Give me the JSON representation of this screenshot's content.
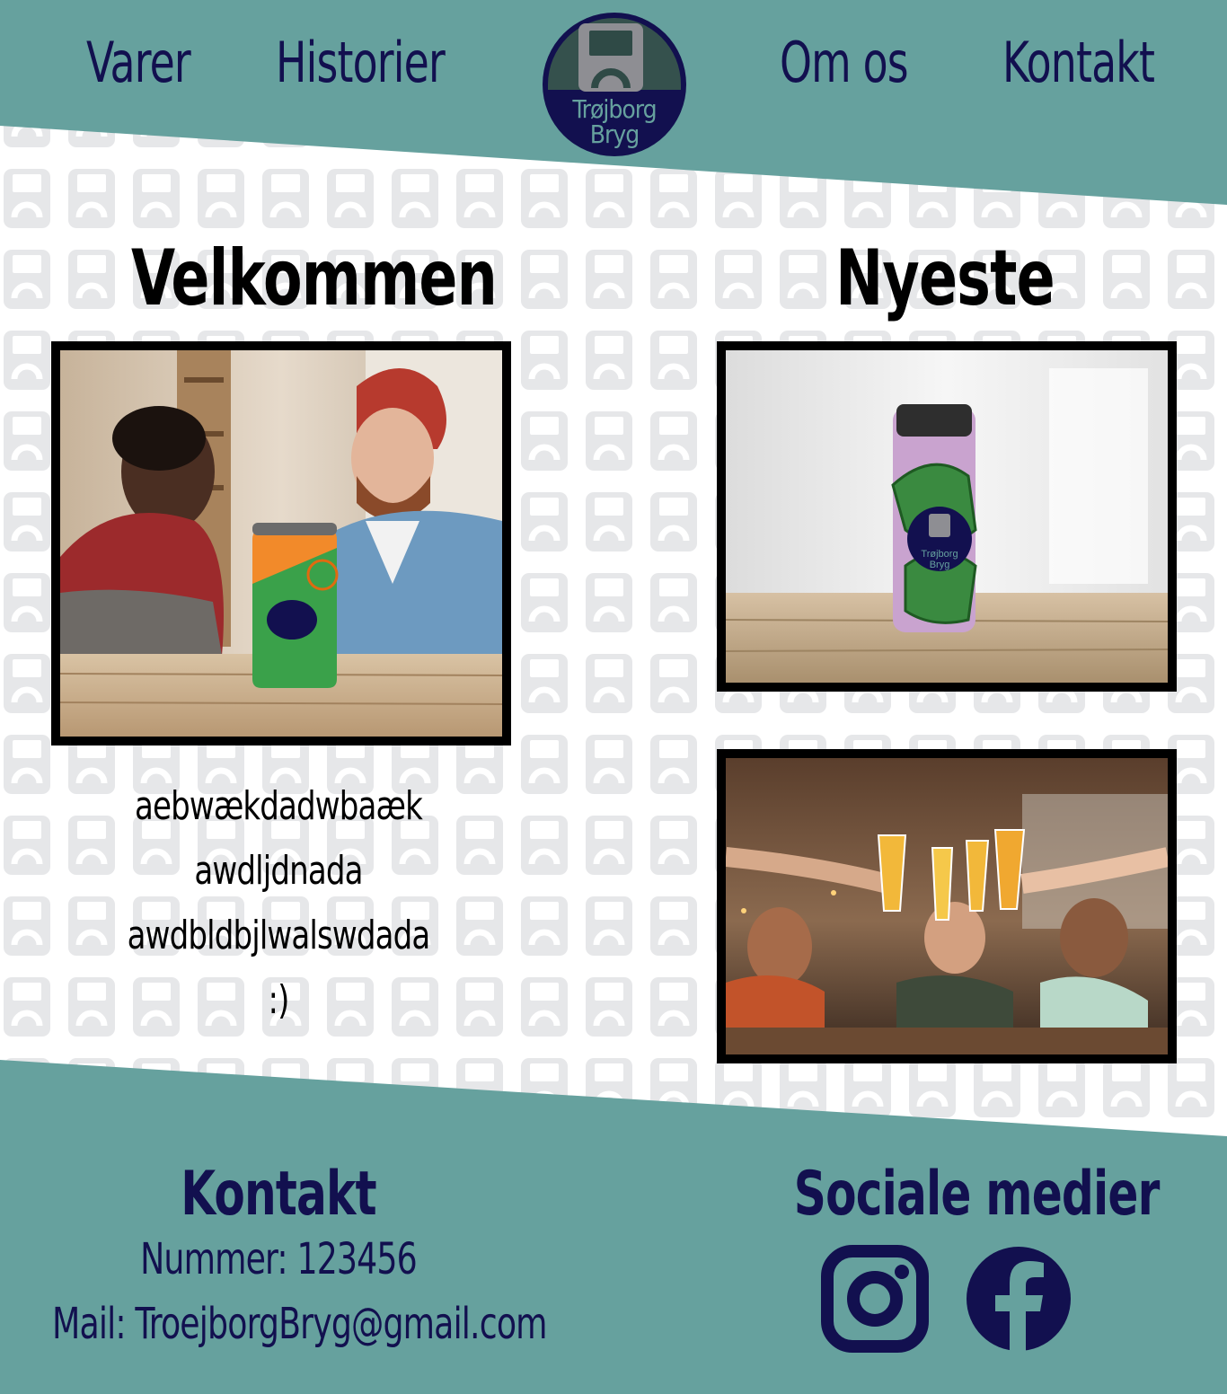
{
  "nav": {
    "items": [
      {
        "label": "Varer"
      },
      {
        "label": "Historier"
      },
      {
        "label": "Om  os"
      },
      {
        "label": "Kontakt"
      }
    ],
    "logo": {
      "line1": "Trøjborg",
      "line2": "Bryg"
    }
  },
  "main": {
    "welcome": {
      "title": "Velkommen",
      "text_lines": [
        "aebwækdadwbaæk",
        "awdljdnada",
        "awdbldbjlwalswdada",
        ":)"
      ],
      "photo": "two-men-with-orange-can-photo"
    },
    "newest": {
      "title": "Nyeste",
      "photo_top": "pink-can-on-table-photo",
      "photo_bottom": "friends-toasting-beer-photo",
      "can_label": {
        "line1": "Trøjborg",
        "line2": "Bryg"
      }
    }
  },
  "footer": {
    "contact": {
      "title": "Kontakt",
      "phone": "Nummer:  123456",
      "mail": "Mail:  TroejborgBryg@gmail.com"
    },
    "social": {
      "title": "Sociale  medier",
      "icons": [
        "instagram-icon",
        "facebook-icon"
      ]
    }
  },
  "colors": {
    "teal": "#66a19e",
    "navy": "#12104f",
    "pattern_gray": "#e6e7e9"
  }
}
